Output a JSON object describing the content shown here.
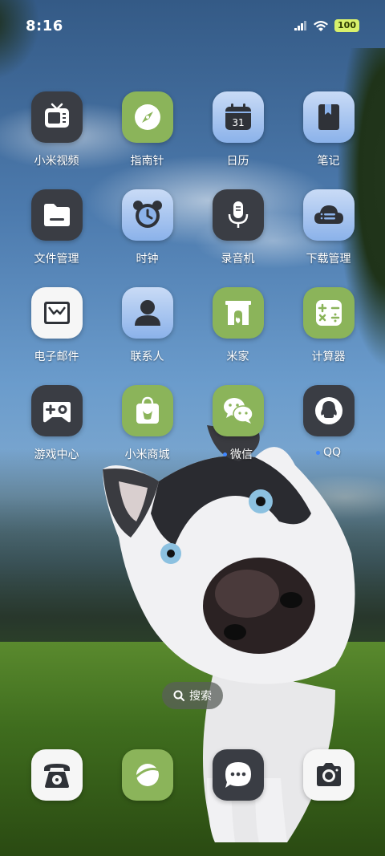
{
  "status": {
    "time": "8:16",
    "battery": "100",
    "signal_icon": "signal-icon",
    "wifi_icon": "wifi-icon"
  },
  "apps": [
    {
      "label": "小米视频",
      "icon": "tv-icon"
    },
    {
      "label": "指南针",
      "icon": "compass-icon"
    },
    {
      "label": "日历",
      "icon": "calendar-icon",
      "calendar_day": "31"
    },
    {
      "label": "笔记",
      "icon": "notes-icon"
    },
    {
      "label": "文件管理",
      "icon": "folder-icon"
    },
    {
      "label": "时钟",
      "icon": "alarm-clock-icon"
    },
    {
      "label": "录音机",
      "icon": "microphone-icon"
    },
    {
      "label": "下载管理",
      "icon": "cloud-download-icon"
    },
    {
      "label": "电子邮件",
      "icon": "mail-icon"
    },
    {
      "label": "联系人",
      "icon": "contact-icon"
    },
    {
      "label": "米家",
      "icon": "fireplace-icon"
    },
    {
      "label": "计算器",
      "icon": "calculator-icon"
    },
    {
      "label": "游戏中心",
      "icon": "gamepad-icon"
    },
    {
      "label": "小米商城",
      "icon": "shopping-bag-icon"
    },
    {
      "label": "微信",
      "icon": "wechat-icon",
      "new_badge": true
    },
    {
      "label": "QQ",
      "icon": "qq-penguin-icon",
      "new_badge": true
    }
  ],
  "search": {
    "label": "搜索",
    "icon": "search-icon"
  },
  "dock": [
    {
      "name": "phone",
      "icon": "telephone-icon"
    },
    {
      "name": "browser",
      "icon": "browser-planet-icon"
    },
    {
      "name": "messages",
      "icon": "message-bubble-icon"
    },
    {
      "name": "camera",
      "icon": "camera-icon"
    }
  ],
  "colors": {
    "icon_dark": "#3a3d44",
    "icon_green": "#8bb45a",
    "icon_blue": "#8bb2ea",
    "battery": "#d8f06b",
    "badge_dot": "#3f86ff"
  }
}
